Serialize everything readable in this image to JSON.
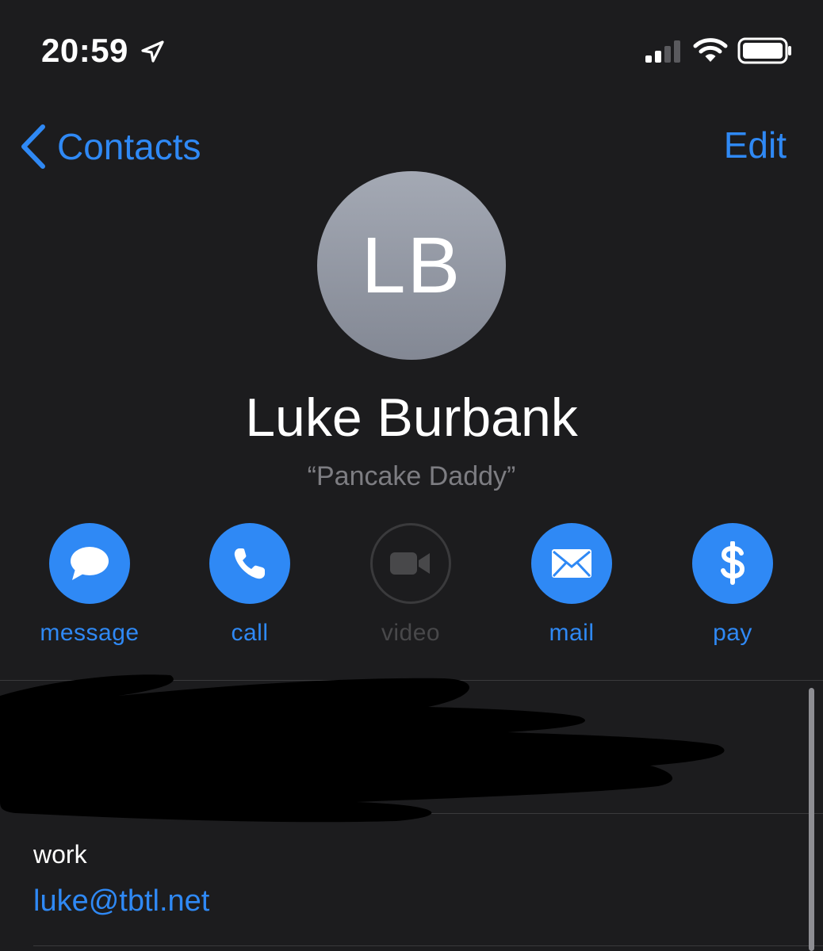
{
  "status_bar": {
    "time": "20:59",
    "icons": [
      "location-arrow-icon",
      "cellular-signal-icon",
      "wifi-icon",
      "battery-icon"
    ]
  },
  "nav": {
    "back_label": "Contacts",
    "edit_label": "Edit"
  },
  "contact": {
    "initials": "LB",
    "name": "Luke Burbank",
    "nickname": "“Pancake Daddy”"
  },
  "actions": [
    {
      "label": "message",
      "icon": "message-bubble-icon",
      "enabled": true
    },
    {
      "label": "call",
      "icon": "phone-icon",
      "enabled": true
    },
    {
      "label": "video",
      "icon": "video-camera-icon",
      "enabled": false
    },
    {
      "label": "mail",
      "icon": "envelope-icon",
      "enabled": true
    },
    {
      "label": "pay",
      "icon": "dollar-icon",
      "enabled": true
    }
  ],
  "fields": {
    "email_label": "work",
    "email_value": "luke@tbtl.net"
  },
  "colors": {
    "accent": "#2f89f5",
    "background": "#1c1c1e",
    "secondary_text": "#7d7d82",
    "separator": "#3a3a3c"
  }
}
